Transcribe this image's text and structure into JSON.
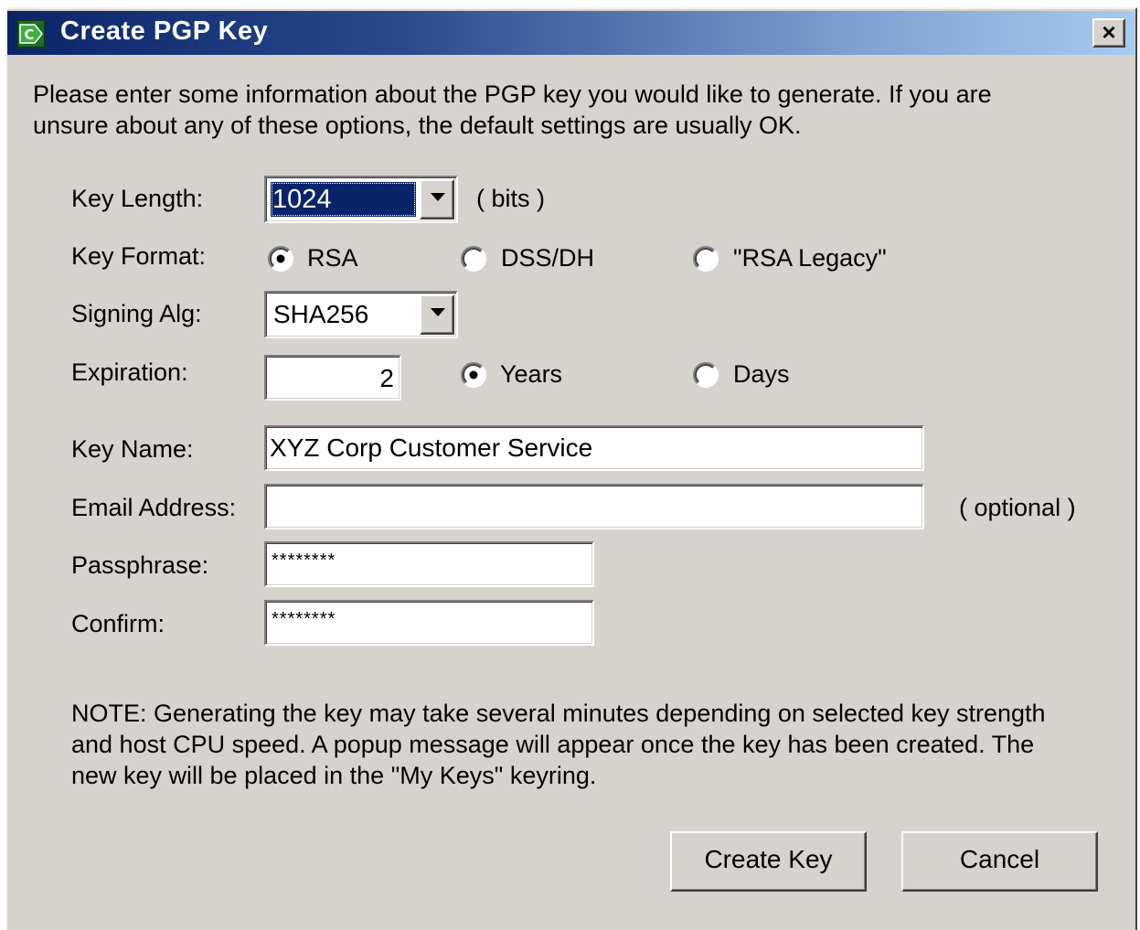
{
  "window": {
    "title": "Create PGP Key",
    "close_label": "×"
  },
  "intro": "Please enter some information about the PGP key you would like to generate. If you are\nunsure about any of these options, the default settings are usually OK.",
  "form": {
    "key_length": {
      "label": "Key Length:",
      "value": "1024",
      "unit": "( bits )"
    },
    "key_format": {
      "label": "Key Format:",
      "options": [
        "RSA",
        "DSS/DH",
        "\"RSA Legacy\""
      ],
      "selected": "RSA"
    },
    "signing_alg": {
      "label": "Signing Alg:",
      "value": "SHA256"
    },
    "expiration": {
      "label": "Expiration:",
      "value": "2",
      "options": [
        "Years",
        "Days"
      ],
      "selected": "Years"
    },
    "key_name": {
      "label": "Key Name:",
      "value": "XYZ Corp Customer Service"
    },
    "email": {
      "label": "Email Address:",
      "value": "",
      "hint": "( optional )"
    },
    "passphrase": {
      "label": "Passphrase:",
      "value": "********"
    },
    "confirm": {
      "label": "Confirm:",
      "value": "********"
    }
  },
  "note": "NOTE: Generating the key may take several minutes depending on selected key strength\nand host CPU speed.  A popup message will appear once the key has been created.  The\nnew key will be placed in the \"My Keys\" keyring.",
  "buttons": {
    "create": "Create Key",
    "cancel": "Cancel"
  },
  "colors": {
    "title_start": "#0a246a",
    "title_end": "#a6caf0",
    "face": "#d6d3ce",
    "selection": "#0a246a"
  },
  "icons": {
    "app": "pgp-app-icon",
    "close": "close-icon",
    "dropdown": "chevron-down-icon"
  }
}
